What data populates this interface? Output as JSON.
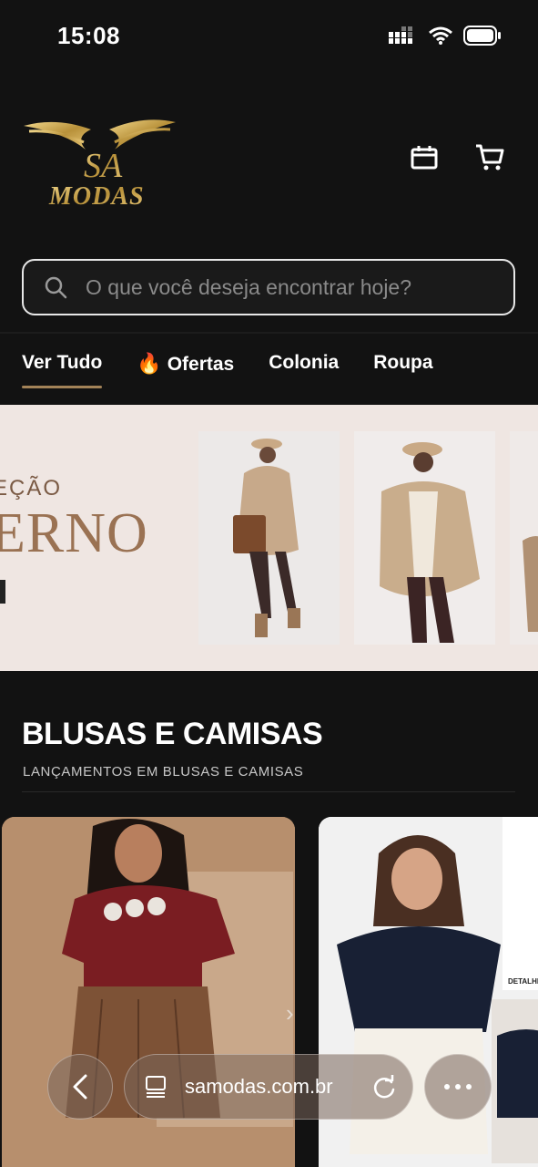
{
  "status": {
    "time": "15:08"
  },
  "brand": {
    "logo_text": "MODAS",
    "monogram": "SA"
  },
  "header": {
    "icons": [
      "calendar-icon",
      "cart-icon"
    ]
  },
  "search": {
    "placeholder": "O que você deseja encontrar hoje?"
  },
  "tabs": [
    {
      "label": "Ver Tudo",
      "active": true
    },
    {
      "label": "Ofertas",
      "icon": "fire-icon"
    },
    {
      "label": "Colonia"
    },
    {
      "label": "Roupa"
    }
  ],
  "banner": {
    "subtitle": "EÇÃO",
    "title": "ERNO"
  },
  "section": {
    "title": "BLUSAS E CAMISAS",
    "subtitle": "LANÇAMENTOS EM BLUSAS E CAMISAS"
  },
  "card2_tag": "DETALHES",
  "browser": {
    "url": "samodas.com.br"
  },
  "colors": {
    "accent": "#a38358",
    "background": "#121212",
    "banner_bg": "#efe6e2"
  }
}
